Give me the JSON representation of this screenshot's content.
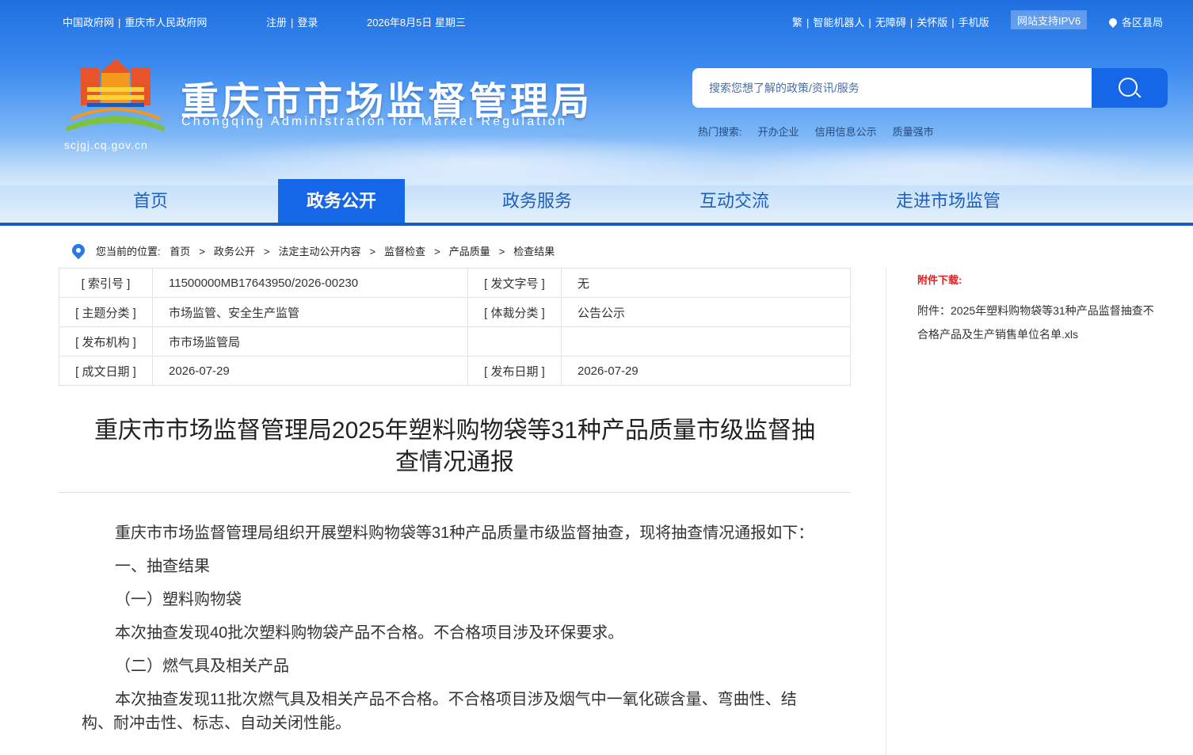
{
  "topbar": {
    "gov_link": "中国政府网",
    "cq_link": "重庆市人民政府网",
    "register": "注册",
    "login": "登录",
    "date": "2026年8月5日 星期三",
    "traditional": "繁",
    "robot": "智能机器人",
    "accessible": "无障碍",
    "care": "关怀版",
    "mobile": "手机版",
    "ipv6": "网站支持IPV6",
    "districts": "各区县局"
  },
  "brand": {
    "title": "重庆市市场监督管理局",
    "subtitle": "Chongqing  Administration for Market Regulation",
    "url": "scjgj.cq.gov.cn"
  },
  "search": {
    "placeholder": "搜索您想了解的政策/资讯/服务",
    "hot_label": "热门搜索:",
    "hot": [
      "开办企业",
      "信用信息公示",
      "质量强市"
    ]
  },
  "nav": [
    "首页",
    "政务公开",
    "政务服务",
    "互动交流",
    "走进市场监管"
  ],
  "breadcrumb": {
    "label": "您当前的位置:",
    "items": [
      "首页",
      "政务公开",
      "法定主动公开内容",
      "监督检查",
      "产品质量",
      "检查结果"
    ]
  },
  "meta": {
    "index_key": "[ 索引号 ]",
    "index_val": "11500000MB17643950/2026-00230",
    "docno_key": "[ 发文字号 ]",
    "docno_val": "无",
    "topic_key": "[ 主题分类 ]",
    "topic_val": "市场监管、安全生产监管",
    "genre_key": "[ 体裁分类 ]",
    "genre_val": "公告公示",
    "org_key": "[ 发布机构 ]",
    "org_val": "市市场监管局",
    "made_key": "[ 成文日期 ]",
    "made_val": "2026-07-29",
    "pub_key": "[ 发布日期 ]",
    "pub_val": "2026-07-29"
  },
  "article": {
    "title_line1": "重庆市市场监督管理局2025年塑料购物袋等31种产品质量市级监督抽",
    "title_line2": "查情况通报",
    "p1": "重庆市市场监督管理局组织开展塑料购物袋等31种产品质量市级监督抽查，现将抽查情况通报如下：",
    "h1": "一、抽查结果",
    "h1_1": "（一）塑料购物袋",
    "p2": "本次抽查发现40批次塑料购物袋产品不合格。不合格项目涉及环保要求。",
    "h1_2": "（二）燃气具及相关产品",
    "p3": "本次抽查发现11批次燃气具及相关产品不合格。不合格项目涉及烟气中一氧化碳含量、弯曲性、结构、耐冲击性、标志、自动关闭性能。"
  },
  "sidebar": {
    "title": "附件下载:",
    "attachment": "附件：2025年塑料购物袋等31种产品监督抽查不合格产品及生产销售单位名单.xls"
  }
}
